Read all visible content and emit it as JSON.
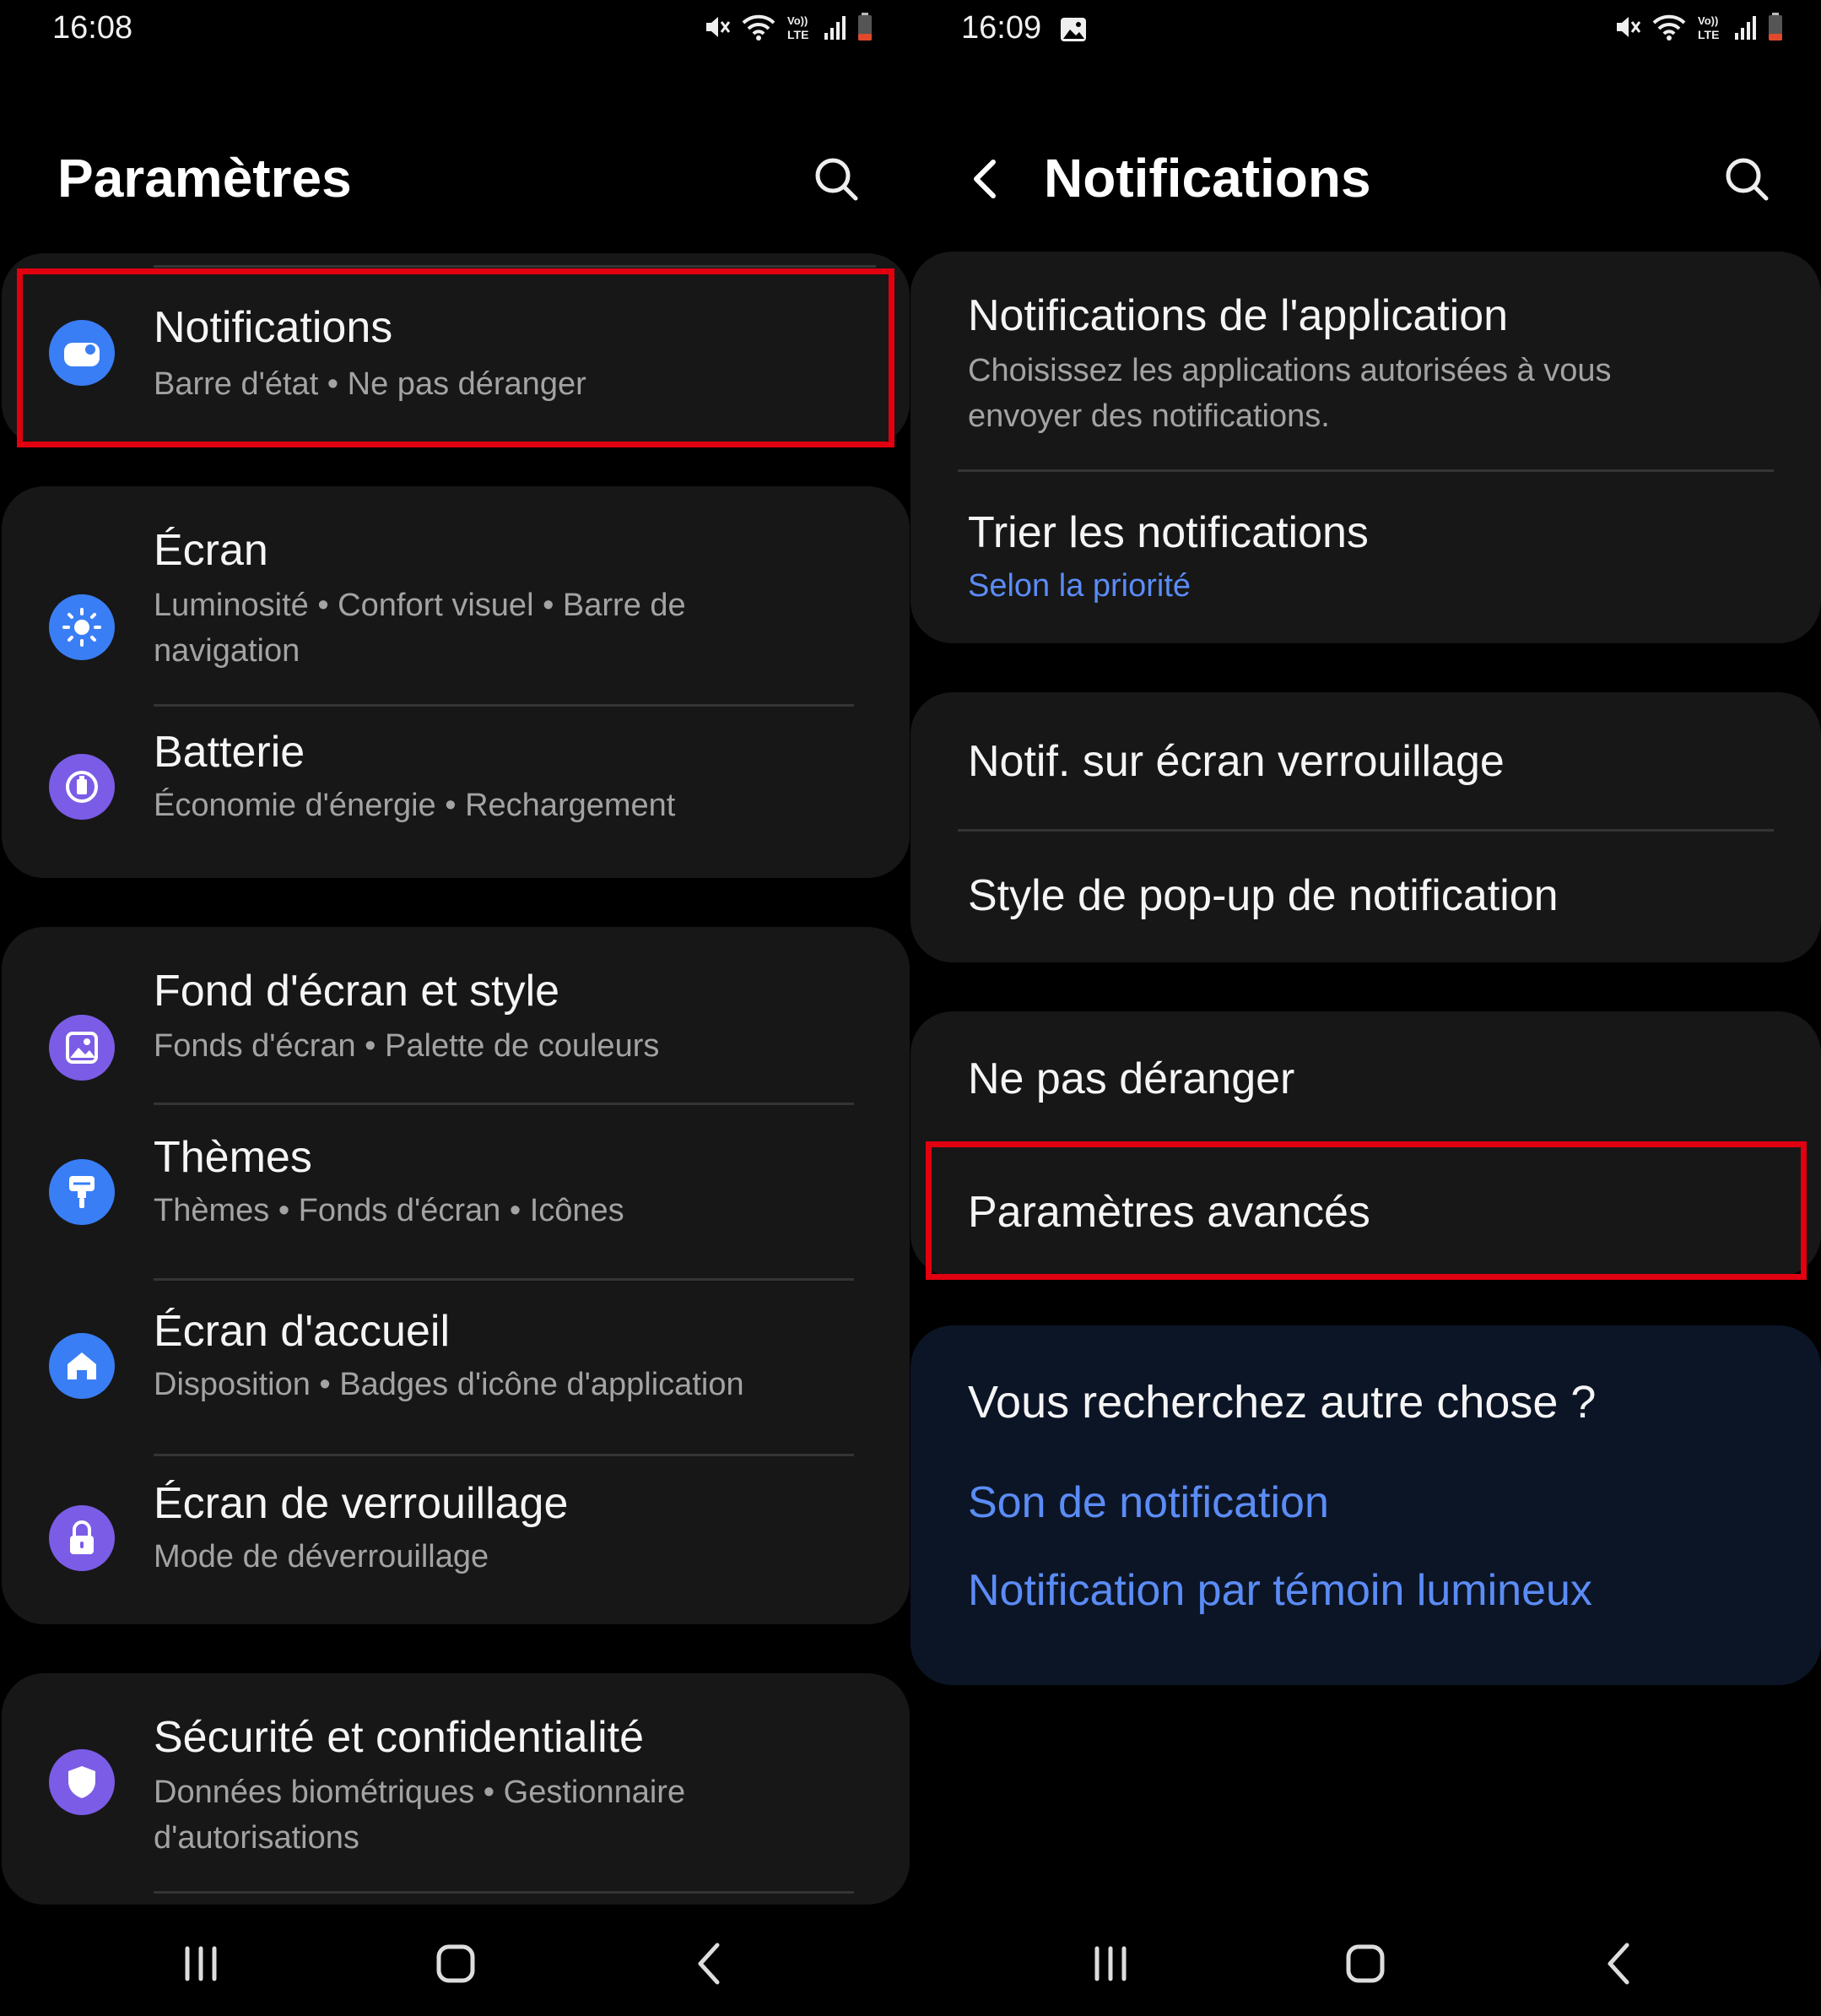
{
  "left": {
    "status_time": "16:08",
    "header_title": "Paramètres",
    "items": [
      {
        "title": "Notifications",
        "sub": "Barre d'état  •  Ne pas déranger"
      },
      {
        "title": "Écran",
        "sub": "Luminosité  •  Confort visuel  •  Barre de navigation"
      },
      {
        "title": "Batterie",
        "sub": "Économie d'énergie  •  Rechargement"
      },
      {
        "title": "Fond d'écran et style",
        "sub": "Fonds d'écran  •  Palette de couleurs"
      },
      {
        "title": "Thèmes",
        "sub": "Thèmes  •  Fonds d'écran  •  Icônes"
      },
      {
        "title": "Écran d'accueil",
        "sub": "Disposition  •  Badges d'icône d'application"
      },
      {
        "title": "Écran de verrouillage",
        "sub": "Mode de déverrouillage"
      },
      {
        "title": "Sécurité et confidentialité",
        "sub": "Données biométriques  •  Gestionnaire d'autorisations"
      }
    ]
  },
  "right": {
    "status_time": "16:09",
    "header_title": "Notifications",
    "items": [
      {
        "title": "Notifications de l'application",
        "sub": "Choisissez les applications autorisées à vous envoyer des notifications."
      },
      {
        "title": "Trier les notifications",
        "sub": "Selon la priorité"
      },
      {
        "title": "Notif. sur écran verrouillage"
      },
      {
        "title": "Style de pop-up de notification"
      },
      {
        "title": "Ne pas déranger"
      },
      {
        "title": "Paramètres avancés"
      }
    ],
    "suggest": {
      "title": "Vous recherchez autre chose ?",
      "links": [
        "Son de notification",
        "Notification par témoin lumineux"
      ]
    }
  },
  "colors": {
    "background": "#000000",
    "card": "#171717",
    "suggest_card": "#0c1526",
    "link": "#5b8cf6",
    "highlight": "#e0000f",
    "icon_blue": "#3a7ef5",
    "icon_purple": "#7b5ce6"
  },
  "icons": [
    "search-icon",
    "back-arrow-icon",
    "mute-icon",
    "wifi-icon",
    "volte-icon",
    "signal-icon",
    "battery-icon",
    "gallery-icon",
    "recents-icon",
    "home-icon",
    "nav-back-icon"
  ]
}
